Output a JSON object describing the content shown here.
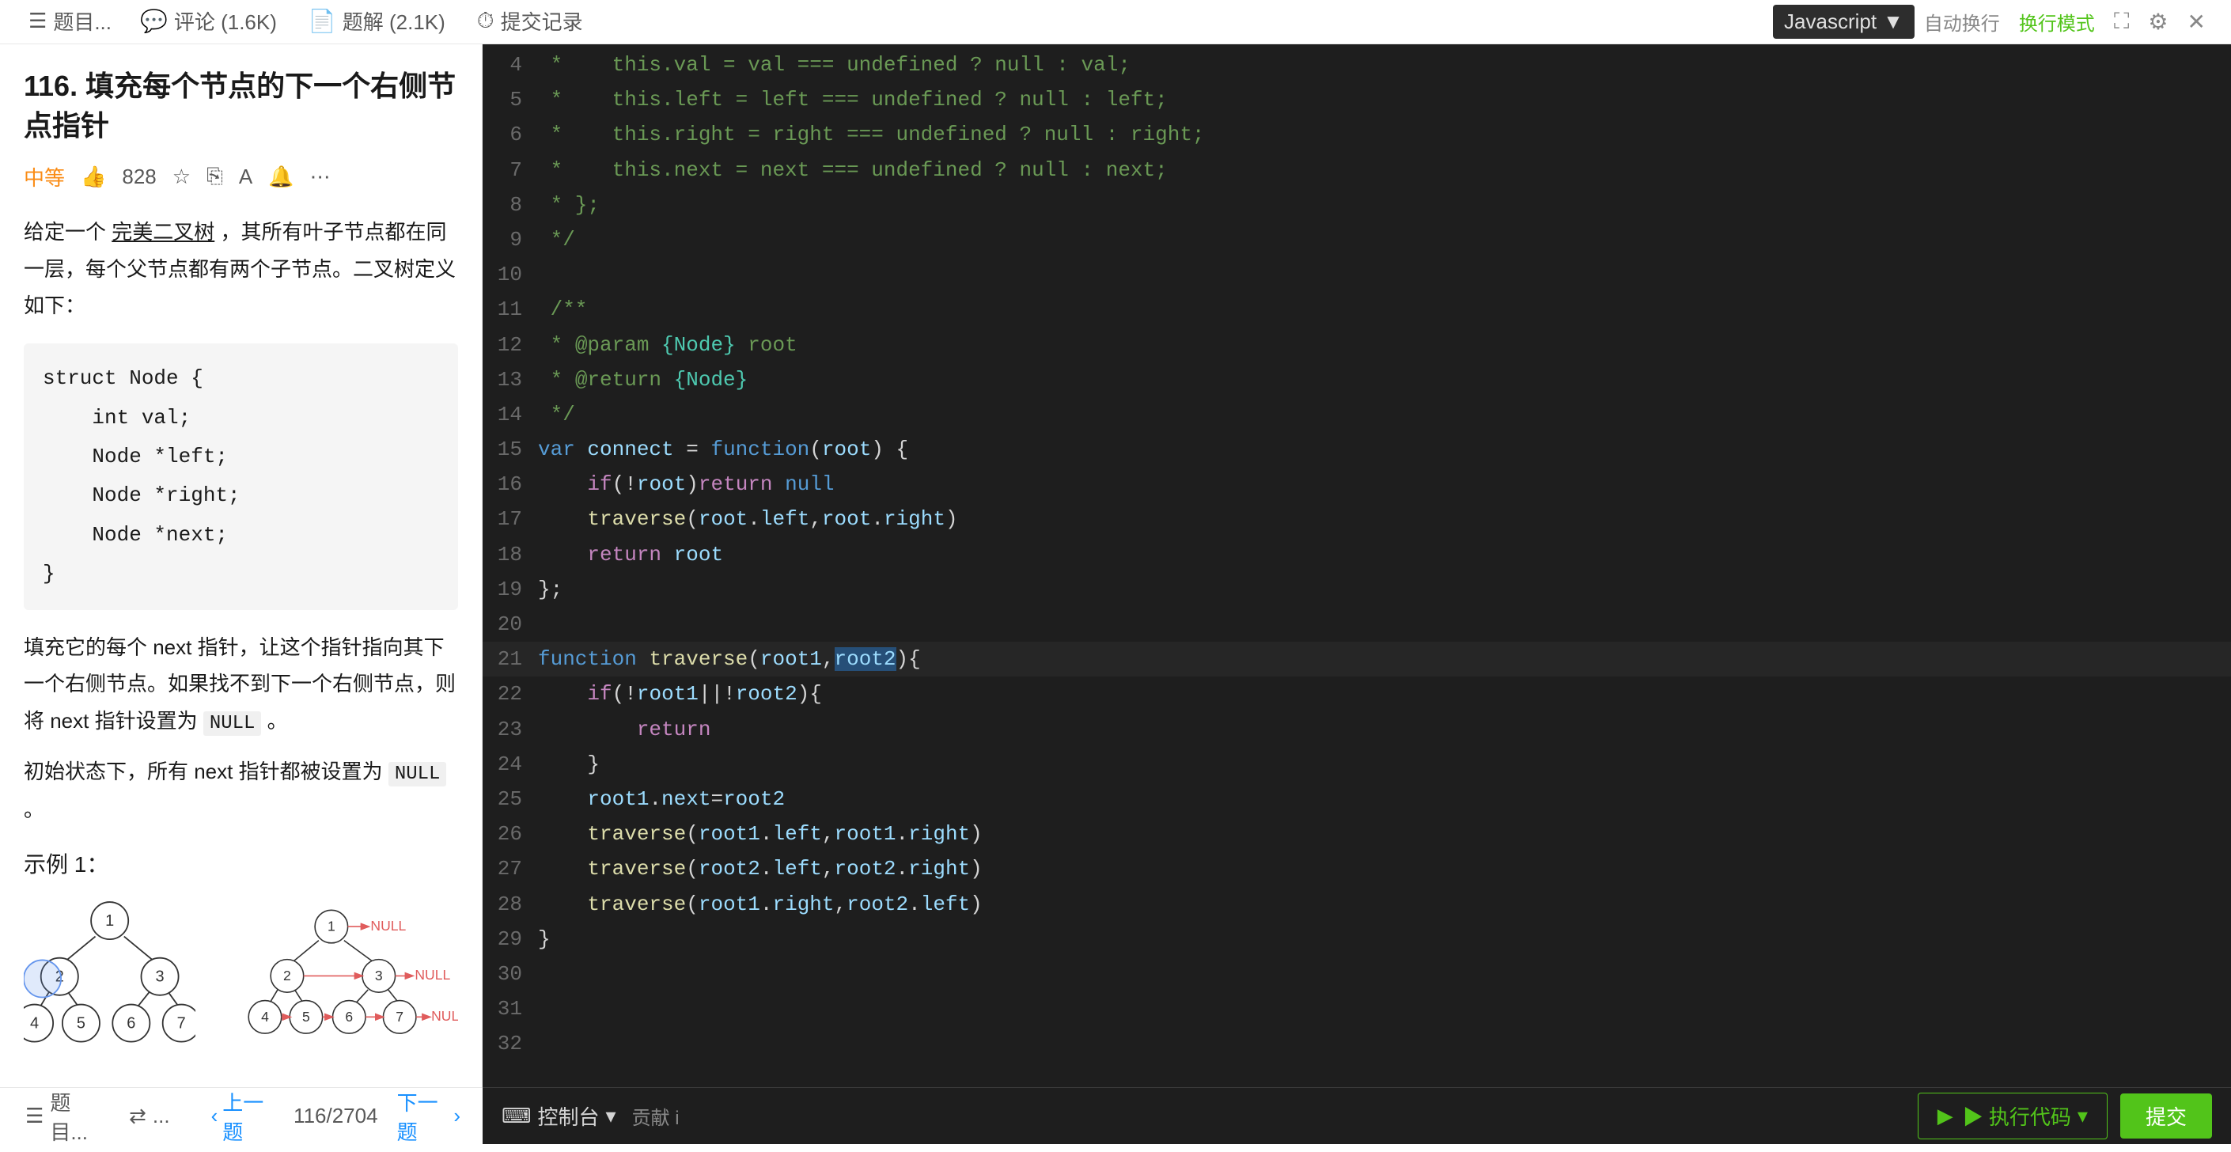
{
  "tabs": [
    {
      "id": "description",
      "label": "题目描述",
      "active": false
    },
    {
      "id": "comments",
      "label": "评论 (1.6K)",
      "active": false
    },
    {
      "id": "solutions",
      "label": "题解 (2.1K)",
      "active": false
    },
    {
      "id": "submissions",
      "label": "提交记录",
      "active": false
    }
  ],
  "problem": {
    "id": "116",
    "title": "116. 填充每个节点的下一个右侧节点指针",
    "difficulty": "中等",
    "likes": "828",
    "description_line1": "给定一个 完美二叉树 ，其所有叶子节点都在同一层，每个父节点都有两个子节点。二叉树定义如下：",
    "code_block": "struct Node {\n    int val;\n    Node *left;\n    Node *right;\n    Node *next;\n}",
    "note1": "填充它的每个 next 指针，让这个指针指向其下一个右侧节点。如果找不到下一个右侧节点，则将 next 指针设置为 NULL 。",
    "note2": "初始状态下，所有 next 指针都被设置为 NULL 。",
    "example_title": "示例 1："
  },
  "toolbar": {
    "language": "Javascript",
    "auto_check": "自动换行",
    "reset_label": "换行模式"
  },
  "code_lines": [
    {
      "num": 4,
      "content": " *    this.val = val === undefined ? null : val;",
      "type": "comment"
    },
    {
      "num": 5,
      "content": " *    this.left = left === undefined ? null : left;",
      "type": "comment"
    },
    {
      "num": 6,
      "content": " *    this.right = right === undefined ? null : right;",
      "type": "comment"
    },
    {
      "num": 7,
      "content": " *    this.next = next === undefined ? null : next;",
      "type": "comment"
    },
    {
      "num": 8,
      "content": " * };",
      "type": "comment"
    },
    {
      "num": 9,
      "content": " */",
      "type": "comment"
    },
    {
      "num": 10,
      "content": "",
      "type": "empty"
    },
    {
      "num": 11,
      "content": " /**",
      "type": "comment"
    },
    {
      "num": 12,
      "content": " * @param {Node} root",
      "type": "comment"
    },
    {
      "num": 13,
      "content": " * @return {Node}",
      "type": "comment"
    },
    {
      "num": 14,
      "content": " */",
      "type": "comment"
    },
    {
      "num": 15,
      "content": "var connect = function(root) {",
      "type": "code"
    },
    {
      "num": 16,
      "content": "    if(!root)return null",
      "type": "code"
    },
    {
      "num": 17,
      "content": "    traverse(root.left,root.right)",
      "type": "code"
    },
    {
      "num": 18,
      "content": "    return root",
      "type": "code"
    },
    {
      "num": 19,
      "content": "};",
      "type": "code"
    },
    {
      "num": 20,
      "content": "",
      "type": "empty"
    },
    {
      "num": 21,
      "content": "function traverse(root1,root2){",
      "type": "code",
      "highlight": true
    },
    {
      "num": 22,
      "content": "    if(!root1||!root2){",
      "type": "code"
    },
    {
      "num": 23,
      "content": "        return",
      "type": "code"
    },
    {
      "num": 24,
      "content": "    }",
      "type": "code"
    },
    {
      "num": 25,
      "content": "    root1.next=root2",
      "type": "code"
    },
    {
      "num": 26,
      "content": "    traverse(root1.left,root1.right)",
      "type": "code"
    },
    {
      "num": 27,
      "content": "    traverse(root2.left,root2.right)",
      "type": "code"
    },
    {
      "num": 28,
      "content": "    traverse(root1.right,root2.left)",
      "type": "code"
    },
    {
      "num": 29,
      "content": "}",
      "type": "code"
    },
    {
      "num": 30,
      "content": "",
      "type": "empty"
    },
    {
      "num": 31,
      "content": "",
      "type": "empty"
    },
    {
      "num": 32,
      "content": "",
      "type": "empty"
    }
  ],
  "bottom": {
    "menu_label": "题目...",
    "random_label": "...",
    "prev_label": "上一题",
    "page_info": "116/2704",
    "next_label": "下一题",
    "console_label": "控制台",
    "contribute_label": "贡献 i",
    "run_label": "▶ 执行代码",
    "submit_label": "提交"
  },
  "colors": {
    "accent": "#52c41a",
    "primary": "#1890ff",
    "difficulty_medium": "#fa8c16",
    "bg_dark": "#1e1e1e",
    "bg_toolbar": "#2d2d2d"
  }
}
